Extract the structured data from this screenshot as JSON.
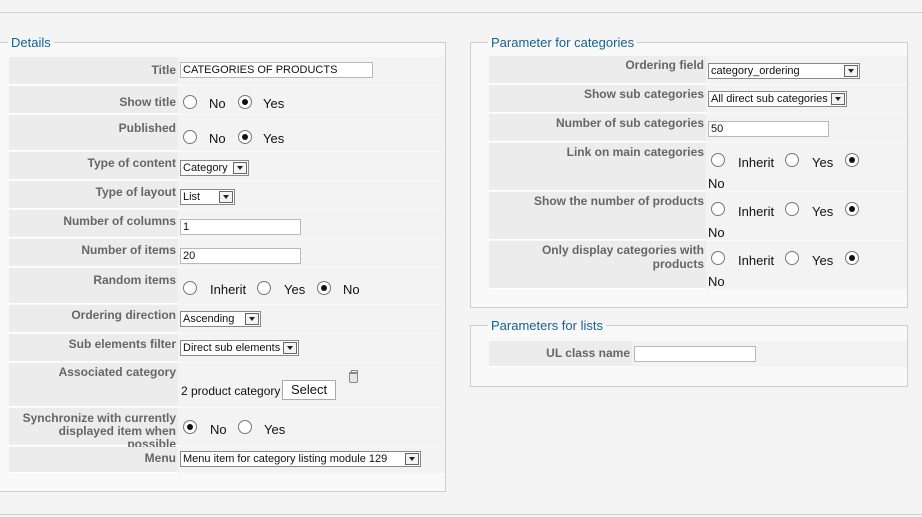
{
  "details": {
    "legend": "Details",
    "title": {
      "label": "Title",
      "value": "CATEGORIES OF PRODUCTS"
    },
    "show_title": {
      "label": "Show title",
      "opt_no": "No",
      "opt_yes": "Yes",
      "selected": "Yes"
    },
    "published": {
      "label": "Published",
      "opt_no": "No",
      "opt_yes": "Yes",
      "selected": "Yes"
    },
    "type_of_content": {
      "label": "Type of content",
      "value": "Category"
    },
    "type_of_layout": {
      "label": "Type of layout",
      "value": "List"
    },
    "number_of_columns": {
      "label": "Number of columns",
      "value": "1"
    },
    "number_of_items": {
      "label": "Number of items",
      "value": "20"
    },
    "random_items": {
      "label": "Random items",
      "opt_inherit": "Inherit",
      "opt_yes": "Yes",
      "opt_no": "No",
      "selected": "No"
    },
    "ordering_direction": {
      "label": "Ordering direction",
      "value": "Ascending"
    },
    "sub_elements_filter": {
      "label": "Sub elements filter",
      "value": "Direct sub elements"
    },
    "associated_category": {
      "label": "Associated category",
      "value": "2 product category",
      "select_label": "Select",
      "icon": "trash-icon"
    },
    "synchronize": {
      "label_line1": "Synchronize with currently",
      "label_line2": "displayed item when possible",
      "opt_no": "No",
      "opt_yes": "Yes",
      "selected": "No"
    },
    "menu": {
      "label": "Menu",
      "value": "Menu item for category listing module 129"
    }
  },
  "params": {
    "legend": "Parameter for categories",
    "ordering_field": {
      "label": "Ordering field",
      "value": "category_ordering"
    },
    "show_sub_categories": {
      "label": "Show sub categories",
      "value": "All direct sub categories"
    },
    "number_of_sub_categories": {
      "label": "Number of sub categories",
      "value": "50"
    },
    "link_on_main_categories": {
      "label": "Link on main categories",
      "opt_inherit": "Inherit",
      "opt_yes": "Yes",
      "opt_no": "No",
      "selected": "No"
    },
    "show_number_of_products": {
      "label": "Show the number of products",
      "opt_inherit": "Inherit",
      "opt_yes": "Yes",
      "opt_no": "No",
      "selected": "No"
    },
    "only_display_with_products": {
      "label": "Only display categories with products",
      "opt_inherit": "Inherit",
      "opt_yes": "Yes",
      "opt_no": "No",
      "selected": "No"
    }
  },
  "lists": {
    "legend": "Parameters for lists",
    "ul_class_name": {
      "label": "UL class name",
      "value": ""
    }
  }
}
